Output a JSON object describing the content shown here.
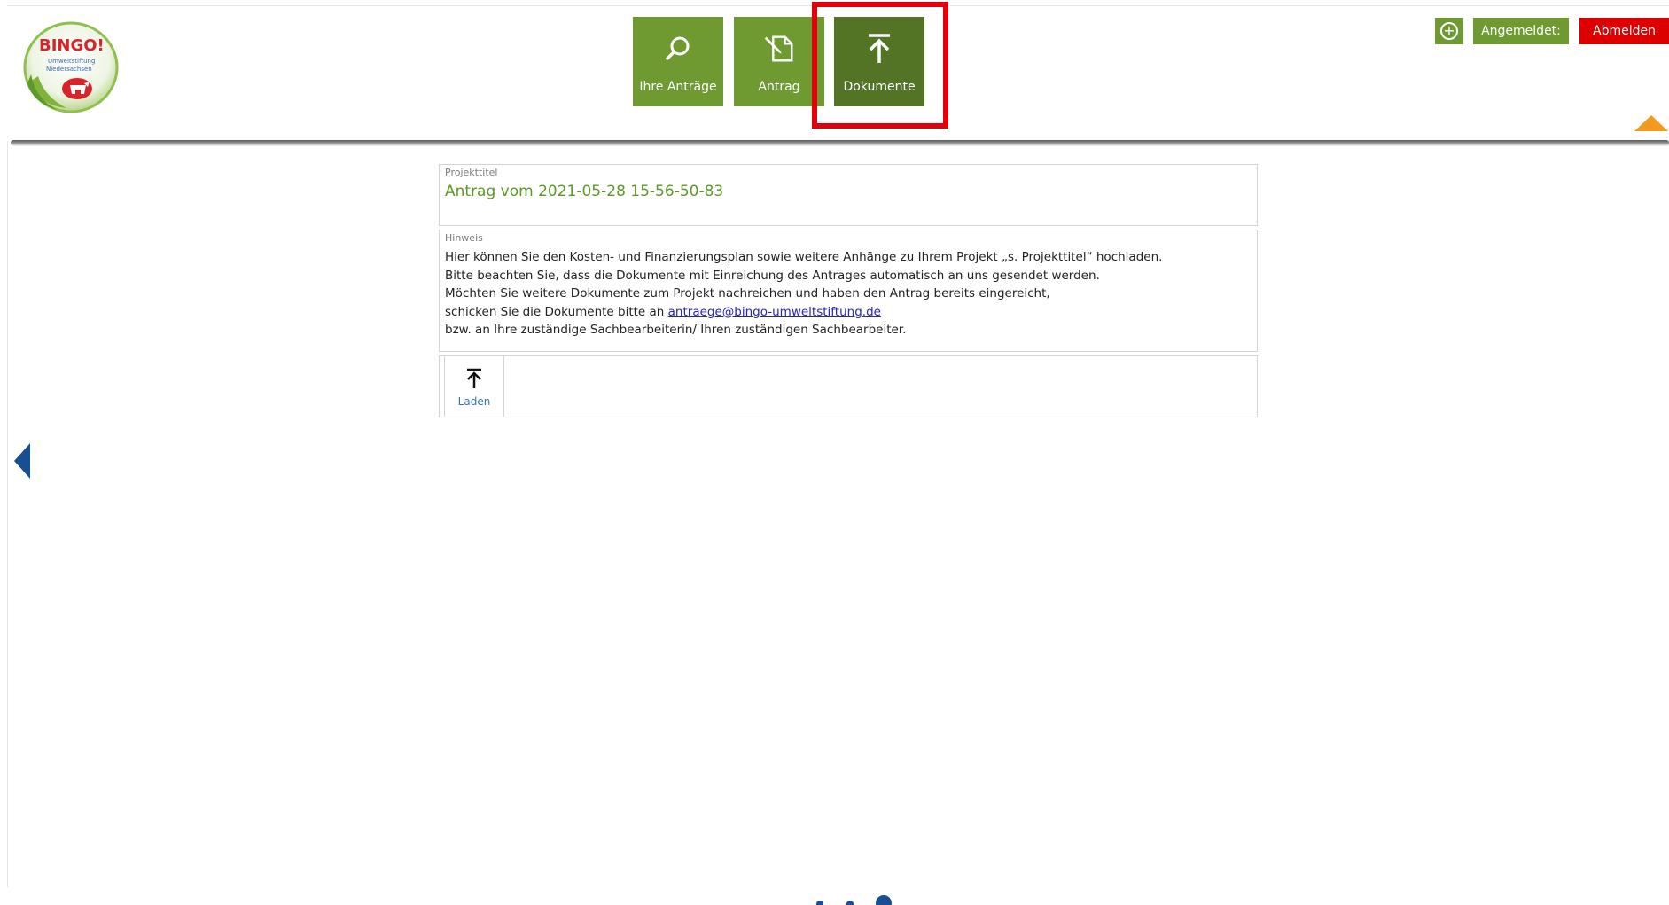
{
  "logo": {
    "brand": "BINGO!",
    "subline1": "Umweltstiftung",
    "subline2": "Niedersachsen"
  },
  "nav": {
    "items": [
      {
        "label": "Ihre Anträge",
        "icon": "search-icon"
      },
      {
        "label": "Antrag",
        "icon": "edit-document-icon"
      },
      {
        "label": "Dokumente",
        "icon": "upload-icon",
        "active": true
      }
    ]
  },
  "header_right": {
    "login_label": "Angemeldet:",
    "logout_label": "Abmelden",
    "plus_symbol": "+"
  },
  "project": {
    "label": "Projekttitel",
    "title": "Antrag vom 2021-05-28 15-56-50-83"
  },
  "note": {
    "label": "Hinweis",
    "line1": "Hier können Sie den Kosten- und Finanzierungsplan sowie weitere Anhänge zu Ihrem Projekt „s. Projekttitel“ hochladen.",
    "line2": "Bitte beachten Sie, dass die Dokumente mit Einreichung des Antrages automatisch an uns gesendet werden.",
    "line3": "Möchten Sie weitere Dokumente zum Projekt nachreichen und haben den Antrag bereits eingereicht,",
    "line4_prefix": "schicken Sie die Dokumente bitte an ",
    "email": "antraege@bingo-umweltstiftung.de",
    "line5": "bzw. an Ihre zuständige Sachbearbeiterin/ Ihren zuständigen Sachbearbeiter."
  },
  "upload": {
    "label": "Laden"
  },
  "colors": {
    "nav_green": "#6e9a31",
    "nav_active": "#537424",
    "logout_red": "#dc0000",
    "highlight_red": "#e3000b",
    "accent_orange": "#f39a1e",
    "side_arrow_blue": "#174f94",
    "title_green": "#5a9a24"
  }
}
